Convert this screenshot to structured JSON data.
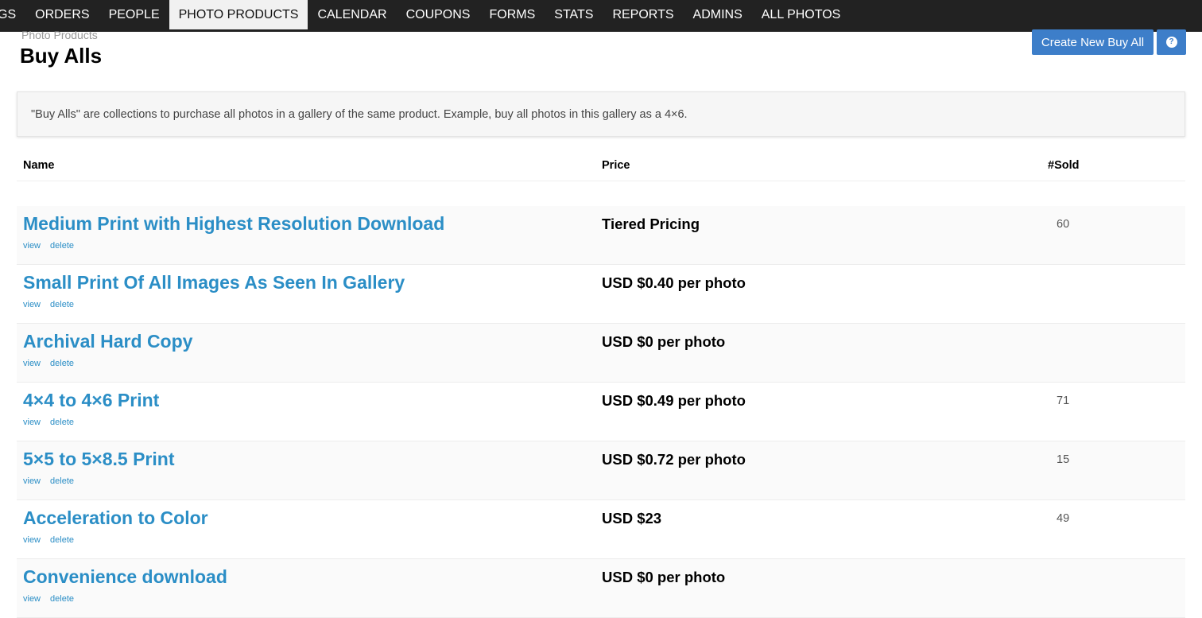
{
  "nav": {
    "items": [
      {
        "label": "GS",
        "active": false
      },
      {
        "label": "ORDERS",
        "active": false
      },
      {
        "label": "PEOPLE",
        "active": false
      },
      {
        "label": "PHOTO PRODUCTS",
        "active": true
      },
      {
        "label": "CALENDAR",
        "active": false
      },
      {
        "label": "COUPONS",
        "active": false
      },
      {
        "label": "FORMS",
        "active": false
      },
      {
        "label": "STATS",
        "active": false
      },
      {
        "label": "REPORTS",
        "active": false
      },
      {
        "label": "ADMINS",
        "active": false
      },
      {
        "label": "ALL PHOTOS",
        "active": false
      }
    ]
  },
  "header": {
    "breadcrumb": "Photo Products",
    "title": "Buy Alls",
    "create_button": "Create New Buy All",
    "help_icon": "question-circle-icon",
    "help_glyph": "?"
  },
  "info": {
    "text": "\"Buy Alls\" are collections to purchase all photos in a gallery of the same product. Example, buy all photos in this gallery as a 4×6."
  },
  "table": {
    "columns": {
      "name": "Name",
      "price": "Price",
      "sold": "#Sold"
    },
    "action_labels": {
      "view": "view",
      "delete": "delete"
    },
    "rows": [
      {
        "name": "Medium Print with Highest Resolution Download",
        "price": "Tiered Pricing",
        "sold": "60"
      },
      {
        "name": "Small Print Of All Images As Seen In Gallery",
        "price": "USD $0.40 per photo",
        "sold": ""
      },
      {
        "name": "Archival Hard Copy",
        "price": "USD $0 per photo",
        "sold": ""
      },
      {
        "name": "4×4 to 4×6 Print",
        "price": "USD $0.49 per photo",
        "sold": "71"
      },
      {
        "name": "5×5 to 5×8.5 Print",
        "price": "USD $0.72 per photo",
        "sold": "15"
      },
      {
        "name": "Acceleration to Color",
        "price": "USD $23",
        "sold": "49"
      },
      {
        "name": "Convenience download",
        "price": "USD $0 per photo",
        "sold": ""
      }
    ]
  },
  "colors": {
    "nav_bg": "#222222",
    "accent": "#3d7ec9",
    "link": "#2b8ec6"
  }
}
